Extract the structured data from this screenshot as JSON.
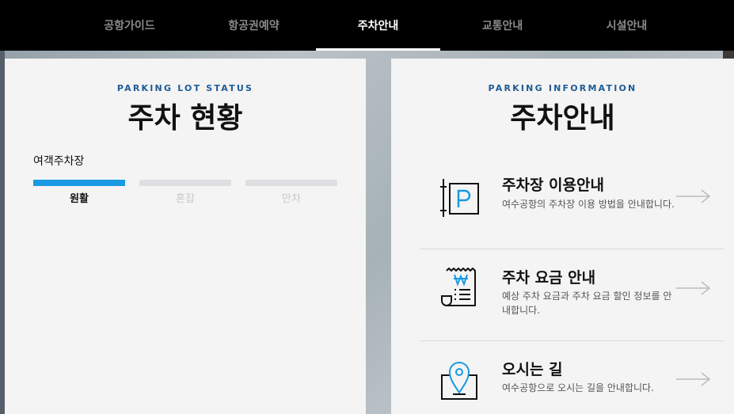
{
  "nav": {
    "items": [
      "공항가이드",
      "항공권예약",
      "주차안내",
      "교통안내",
      "시설안내"
    ],
    "active_index": 2
  },
  "status": {
    "eyebrow": "PARKING LOT STATUS",
    "title": "주차 현황",
    "lot_name": "여객주차장",
    "levels": [
      "원활",
      "혼잡",
      "만차"
    ],
    "current_level": "원활"
  },
  "info": {
    "eyebrow": "PARKING INFORMATION",
    "title": "주차안내",
    "items": [
      {
        "title": "주차장 이용안내",
        "desc": "여수공항의 주차장 이용 방법을 안내합니다.",
        "icon": "parking-sign-icon"
      },
      {
        "title": "주차 요금 안내",
        "desc": "예상 주차 요금과 주차 요금 할인 정보를 안내합니다.",
        "icon": "receipt-won-icon"
      },
      {
        "title": "오시는 길",
        "desc": "여수공항으로 오시는 길을 안내합니다.",
        "icon": "map-pin-icon"
      }
    ]
  },
  "colors": {
    "accent": "#1a9ae4",
    "eyebrow": "#1f5b97",
    "nav_bg": "#000000"
  }
}
